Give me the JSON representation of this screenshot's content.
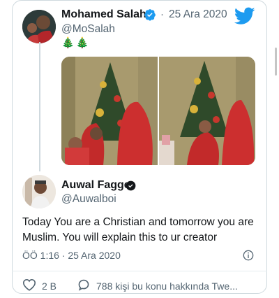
{
  "tweet": {
    "author_name": "Mohamed Salah",
    "separator": "·",
    "date": "25 Ara 2020",
    "handle": "@MoSalah",
    "emojis": "🎄🎄"
  },
  "reply": {
    "author_name": "Auwal Fagge",
    "handle": "@Auwalboi",
    "text": "Today You are a Christian and tomorrow you are Muslim. You will explain this to ur creator",
    "timestamp": "ÖÖ 1:16 · 25 Ara 2020"
  },
  "actions": {
    "likes": "2 B",
    "replies": "788 kişi bu konu hakkında Twe..."
  },
  "colors": {
    "twitter_blue": "#1d9bf0",
    "secondary_text": "#536471"
  },
  "icons": [
    "twitter-bird-icon",
    "verified-badge-icon",
    "info-icon",
    "heart-icon",
    "comment-icon",
    "verified-dark-icon"
  ]
}
